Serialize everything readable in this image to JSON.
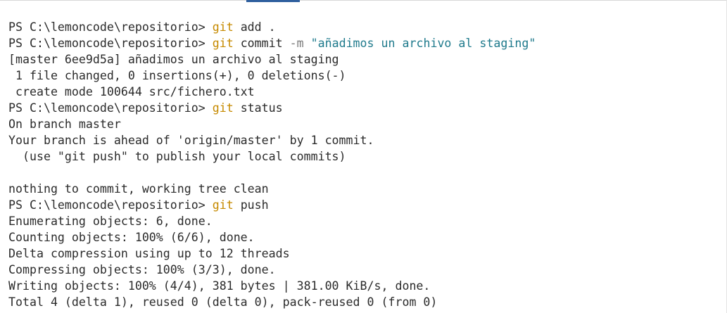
{
  "terminal": {
    "prompt": "PS C:\\lemoncode\\repositorio> ",
    "colors": {
      "text": "#2b2b2b",
      "command": "#c68a00",
      "flag": "#7a7a7a",
      "string": "#1f7a8c",
      "scroll_thumb": "#2f5f9e"
    },
    "lines": [
      {
        "type": "command",
        "cmd": "git",
        "rest": " add ."
      },
      {
        "type": "command",
        "cmd": "git",
        "rest": " commit ",
        "flag": "-m",
        "string": " \"añadimos un archivo al staging\""
      },
      {
        "type": "output",
        "text": "[master 6ee9d5a] añadimos un archivo al staging"
      },
      {
        "type": "output",
        "text": " 1 file changed, 0 insertions(+), 0 deletions(-)"
      },
      {
        "type": "output",
        "text": " create mode 100644 src/fichero.txt"
      },
      {
        "type": "command",
        "cmd": "git",
        "rest": " status"
      },
      {
        "type": "output",
        "text": "On branch master"
      },
      {
        "type": "output",
        "text": "Your branch is ahead of 'origin/master' by 1 commit."
      },
      {
        "type": "output",
        "text": "  (use \"git push\" to publish your local commits)"
      },
      {
        "type": "output",
        "text": ""
      },
      {
        "type": "output",
        "text": "nothing to commit, working tree clean"
      },
      {
        "type": "command",
        "cmd": "git",
        "rest": " push"
      },
      {
        "type": "output",
        "text": "Enumerating objects: 6, done."
      },
      {
        "type": "output",
        "text": "Counting objects: 100% (6/6), done."
      },
      {
        "type": "output",
        "text": "Delta compression using up to 12 threads"
      },
      {
        "type": "output",
        "text": "Compressing objects: 100% (3/3), done."
      },
      {
        "type": "output",
        "text": "Writing objects: 100% (4/4), 381 bytes | 381.00 KiB/s, done."
      },
      {
        "type": "output",
        "text": "Total 4 (delta 1), reused 0 (delta 0), pack-reused 0 (from 0)"
      }
    ]
  }
}
